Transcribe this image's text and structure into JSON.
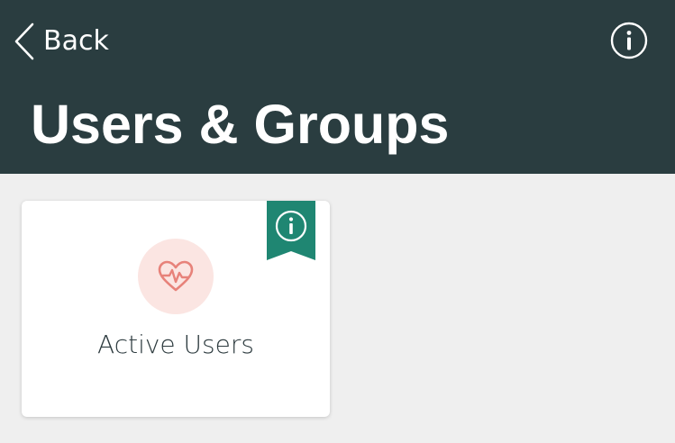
{
  "header": {
    "back_label": "Back",
    "title": "Users & Groups",
    "info_icon": "info-circle-icon",
    "background_color": "#2a3d40"
  },
  "cards": [
    {
      "label": "Active Users",
      "icon": "heart-pulse-icon",
      "badge_icon": "info-circle-icon",
      "icon_color": "#e7827a",
      "icon_bg_color": "#fbe5e2",
      "ribbon_color": "#1f8672"
    }
  ]
}
